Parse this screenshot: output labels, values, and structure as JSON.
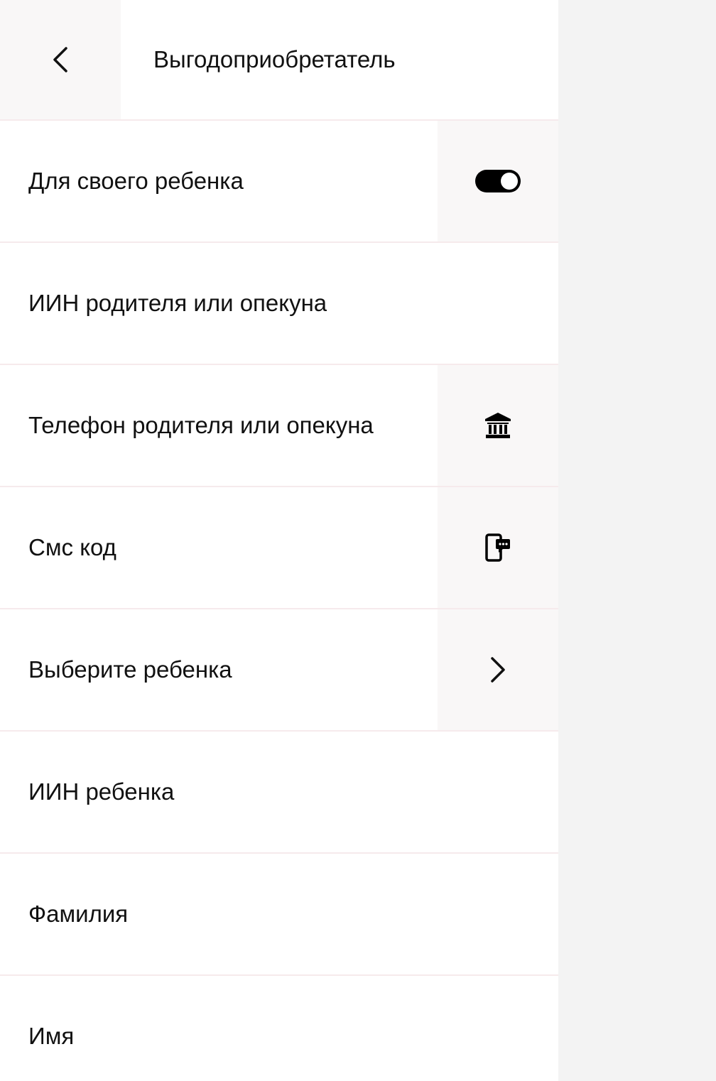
{
  "header": {
    "back_icon": "chevron-left-icon",
    "title": "Выгодоприобретатель"
  },
  "rows": [
    {
      "label": "Для своего ребенка",
      "action": "toggle",
      "toggle_on": true
    },
    {
      "label": "ИИН родителя или опекуна",
      "action": null
    },
    {
      "label": "Телефон родителя или опекуна",
      "action": "bank-icon"
    },
    {
      "label": "Смс код",
      "action": "phone-message-icon"
    },
    {
      "label": "Выберите ребенка",
      "action": "chevron-right-icon"
    },
    {
      "label": "ИИН ребенка",
      "action": null
    },
    {
      "label": "Фамилия",
      "action": null
    },
    {
      "label": "Имя",
      "action": null
    }
  ],
  "colors": {
    "background": "#ffffff",
    "divider": "#f6eaec",
    "action_bg": "#f9f7f7",
    "outer_bg": "#f3f3f3",
    "text": "#111111"
  }
}
